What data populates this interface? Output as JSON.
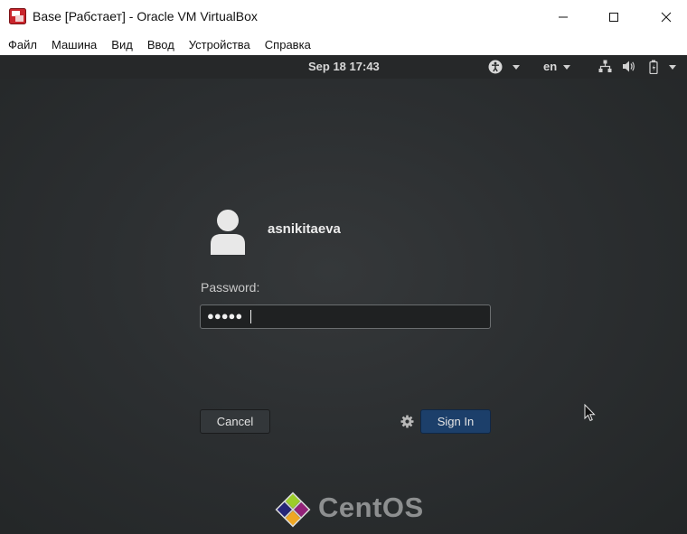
{
  "window": {
    "title": "Base [Рабстает] - Oracle VM VirtualBox",
    "controls": {
      "minimize": "minimize",
      "maximize": "maximize",
      "close": "close"
    }
  },
  "menubar": {
    "items": [
      "Файл",
      "Машина",
      "Вид",
      "Ввод",
      "Устройства",
      "Справка"
    ]
  },
  "gnome_topbar": {
    "datetime": "Sep 18  17:43",
    "language": "en",
    "icons": [
      "accessibility-icon",
      "network-icon",
      "volume-icon",
      "battery-icon",
      "power-menu-icon"
    ]
  },
  "login": {
    "username": "asnikitaeva",
    "password_label": "Password:",
    "password_masked": "●●●●●",
    "cancel_label": "Cancel",
    "signin_label": "Sign In"
  },
  "branding": {
    "logo_text": "CentOS"
  },
  "colors": {
    "background": "#2c2f31",
    "topbar": "#262829",
    "signin_button": "#1c3f6a",
    "text": "#ececec"
  }
}
